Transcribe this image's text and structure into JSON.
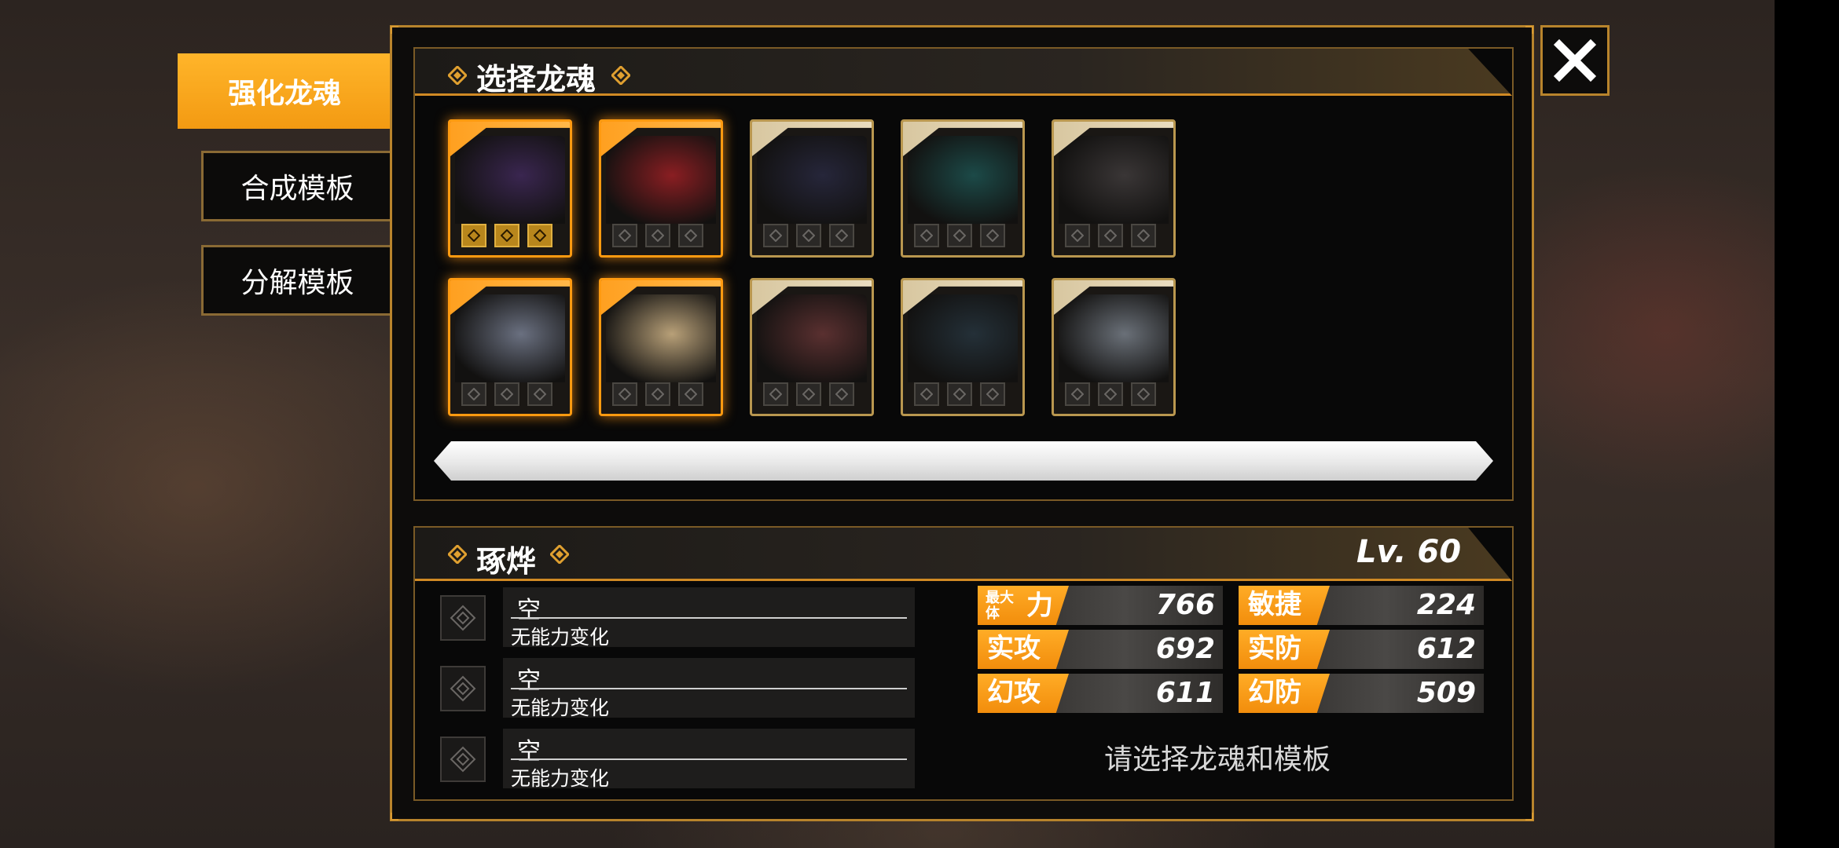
{
  "side_tabs": {
    "active": "强化龙魂",
    "tab2": "合成模板",
    "tab3": "分解模板"
  },
  "select_section": {
    "title": "选择龙魂",
    "dragons": [
      {
        "highlighted": true,
        "gold_slots": true,
        "art": "#3a2650"
      },
      {
        "highlighted": true,
        "gold_slots": false,
        "art": "#8a1e22"
      },
      {
        "highlighted": false,
        "gold_slots": false,
        "art": "#26263a"
      },
      {
        "highlighted": false,
        "gold_slots": false,
        "art": "#1c4a48"
      },
      {
        "highlighted": false,
        "gold_slots": false,
        "art": "#3a3636"
      },
      {
        "highlighted": true,
        "gold_slots": false,
        "art": "#6a7080"
      },
      {
        "highlighted": true,
        "gold_slots": false,
        "art": "#b8a078"
      },
      {
        "highlighted": false,
        "gold_slots": false,
        "art": "#5a3030"
      },
      {
        "highlighted": false,
        "gold_slots": false,
        "art": "#243038"
      },
      {
        "highlighted": false,
        "gold_slots": false,
        "art": "#6a7078"
      }
    ]
  },
  "detail_section": {
    "name": "琢烨",
    "level": "Lv. 60",
    "abilities": [
      {
        "name": "空",
        "desc": "无能力变化"
      },
      {
        "name": "空",
        "desc": "无能力变化"
      },
      {
        "name": "空",
        "desc": "无能力变化"
      }
    ],
    "stats": {
      "hp_label_small": "最大体",
      "hp_label_big": "力",
      "hp_value": "766",
      "agi_label": "敏捷",
      "agi_value": "224",
      "patk_label": "实攻",
      "patk_value": "692",
      "pdef_label": "实防",
      "pdef_value": "612",
      "matk_label": "幻攻",
      "matk_value": "611",
      "mdef_label": "幻防",
      "mdef_value": "509"
    },
    "hint": "请选择龙魂和模板"
  },
  "colors": {
    "accent_orange": "#f7a01a",
    "border_gold": "#b8842c",
    "panel_bg": "#0d0c0b"
  }
}
